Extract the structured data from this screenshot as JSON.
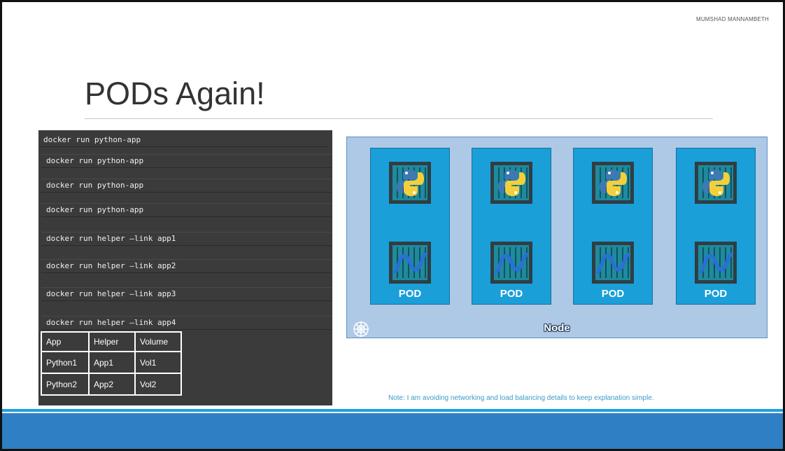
{
  "slide": {
    "author": "MUMSHAD MANNAMBETH",
    "title": "PODs Again!",
    "note": "Note: I am avoiding networking and load balancing details to keep explanation simple."
  },
  "commands": [
    "docker run python-app",
    "docker run python-app",
    "docker run python-app",
    "docker run python-app",
    "docker run helper –link app1",
    "docker run helper –link app2",
    "docker run helper –link app3",
    "docker run helper –link app4"
  ],
  "table": {
    "headers": [
      "App",
      "Helper",
      "Volume"
    ],
    "rows": [
      [
        "Python1",
        "App1",
        "Vol1"
      ],
      [
        "Python2",
        "App2",
        "Vol2"
      ]
    ]
  },
  "node": {
    "label": "Node",
    "icon": "kubernetes-helm-icon",
    "pods": [
      {
        "label": "POD",
        "containers": [
          "python-icon",
          "helper-wave-icon"
        ]
      },
      {
        "label": "POD",
        "containers": [
          "python-icon",
          "helper-wave-icon"
        ]
      },
      {
        "label": "POD",
        "containers": [
          "python-icon",
          "helper-wave-icon"
        ]
      },
      {
        "label": "POD",
        "containers": [
          "python-icon",
          "helper-wave-icon"
        ]
      }
    ]
  },
  "colors": {
    "terminal": "#3b3b3b",
    "node_bg": "#adc9e6",
    "pod": "#1a9fd9",
    "band": "#2e7fc4",
    "note": "#3d9ac9"
  }
}
